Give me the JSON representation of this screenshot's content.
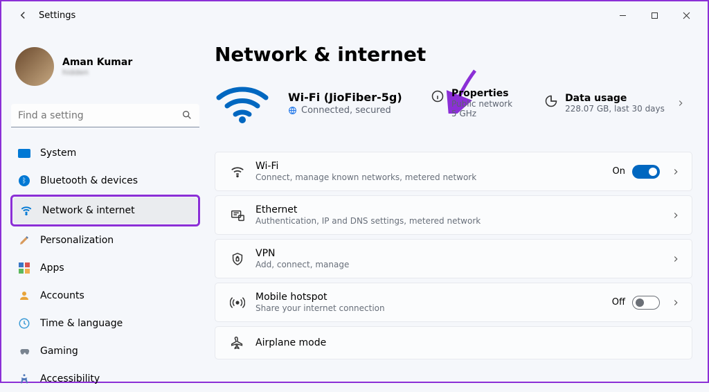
{
  "app": {
    "title": "Settings"
  },
  "user": {
    "name": "Aman Kumar",
    "email": "hidden"
  },
  "search": {
    "placeholder": "Find a setting"
  },
  "nav": [
    {
      "key": "system",
      "label": "System"
    },
    {
      "key": "bluetooth",
      "label": "Bluetooth & devices"
    },
    {
      "key": "network",
      "label": "Network & internet",
      "active": true
    },
    {
      "key": "personalization",
      "label": "Personalization"
    },
    {
      "key": "apps",
      "label": "Apps"
    },
    {
      "key": "accounts",
      "label": "Accounts"
    },
    {
      "key": "time",
      "label": "Time & language"
    },
    {
      "key": "gaming",
      "label": "Gaming"
    },
    {
      "key": "accessibility",
      "label": "Accessibility"
    }
  ],
  "page": {
    "title": "Network & internet",
    "status": {
      "name": "Wi-Fi (JioFiber-5g)",
      "state": "Connected, secured"
    },
    "properties": {
      "title": "Properties",
      "sub1": "Public network",
      "sub2": "5 GHz"
    },
    "usage": {
      "title": "Data usage",
      "sub": "228.07 GB, last 30 days"
    }
  },
  "cards": {
    "wifi": {
      "title": "Wi-Fi",
      "sub": "Connect, manage known networks, metered network",
      "toggle_state": "On"
    },
    "eth": {
      "title": "Ethernet",
      "sub": "Authentication, IP and DNS settings, metered network"
    },
    "vpn": {
      "title": "VPN",
      "sub": "Add, connect, manage"
    },
    "hotspot": {
      "title": "Mobile hotspot",
      "sub": "Share your internet connection",
      "toggle_state": "Off"
    },
    "airplane": {
      "title": "Airplane mode"
    }
  },
  "annotation": {
    "highlight_target": "Network & internet nav item",
    "arrow_target": "Properties tile",
    "color": "#8b2fd6"
  }
}
